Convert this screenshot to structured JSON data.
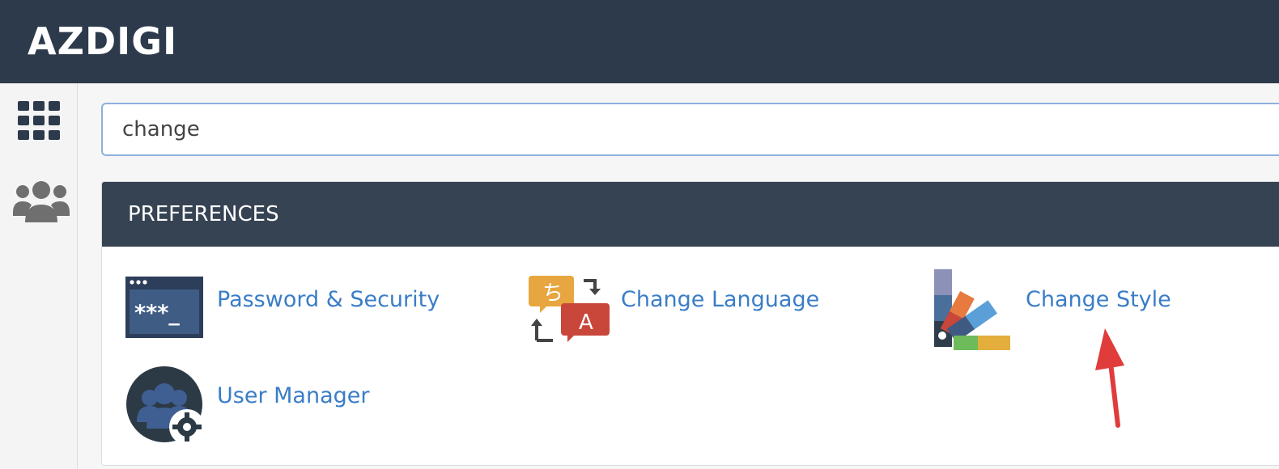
{
  "header": {
    "brand": "AZDIGI"
  },
  "sidebar": {
    "items": [
      {
        "icon": "grid-icon"
      },
      {
        "icon": "users-icon"
      }
    ]
  },
  "search": {
    "value": "change",
    "placeholder": ""
  },
  "section": {
    "title": "PREFERENCES",
    "items": [
      {
        "label": "Password & Security",
        "icon": "password-icon"
      },
      {
        "label": "Change Language",
        "icon": "language-icon"
      },
      {
        "label": "Change Style",
        "icon": "style-palette-icon"
      },
      {
        "label": "User Manager",
        "icon": "user-manager-icon"
      }
    ]
  },
  "annotation": {
    "arrow": "red-arrow-icon",
    "color": "#e03c3c"
  },
  "colors": {
    "header_bg": "#2d3a4b",
    "section_header_bg": "#364353",
    "link": "#3a7dc7"
  }
}
